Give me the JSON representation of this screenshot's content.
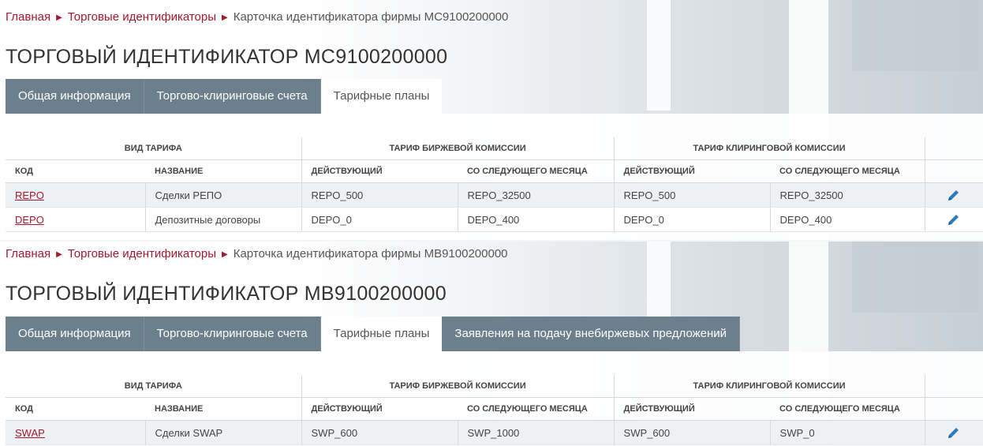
{
  "breadcrumb": {
    "home": "Главная",
    "trade_ids": "Торговые идентификаторы"
  },
  "colors": {
    "link_red": "#a3192e",
    "tab_inactive_bg": "#6b7f8c",
    "tab_active_bg": "#ffffff"
  },
  "panels": [
    {
      "breadcrumb_current": "Карточка идентификатора фирмы MC9100200000",
      "title": "ТОРГОВЫЙ ИДЕНТИФИКАТОР MC9100200000",
      "tabs": [
        "Общая информация",
        "Торгово-клиринговые счета",
        "Тарифные планы"
      ],
      "active_tab": "Тарифные планы",
      "table": {
        "groups": {
          "tariff_type": "ВИД ТАРИФА",
          "exchange_fee": "ТАРИФ БИРЖЕВОЙ КОМИССИИ",
          "clearing_fee": "ТАРИФ КЛИРИНГОВОЙ КОМИССИИ"
        },
        "columns": {
          "code": "КОД",
          "name": "НАЗВАНИЕ",
          "ex_current": "ДЕЙСТВУЮЩИЙ",
          "ex_next": "СО СЛЕДУЮЩЕГО МЕСЯЦА",
          "cl_current": "ДЕЙСТВУЮЩИЙ",
          "cl_next": "СО СЛЕДУЮЩЕГО МЕСЯЦА"
        },
        "rows": [
          {
            "code": "REPO",
            "name": "Сделки РЕПО",
            "ex_current": "REPO_500",
            "ex_next": "REPO_32500",
            "cl_current": "REPO_500",
            "cl_next": "REPO_32500"
          },
          {
            "code": "DEPO",
            "name": "Депозитные договоры",
            "ex_current": "DEPO_0",
            "ex_next": "DEPO_400",
            "cl_current": "DEPO_0",
            "cl_next": "DEPO_400"
          }
        ]
      }
    },
    {
      "breadcrumb_current": "Карточка идентификатора фирмы MB9100200000",
      "title": "ТОРГОВЫЙ ИДЕНТИФИКАТОР MB9100200000",
      "tabs": [
        "Общая информация",
        "Торгово-клиринговые счета",
        "Тарифные планы",
        "Заявления на подачу внебиржевых предложений"
      ],
      "active_tab": "Тарифные планы",
      "table": {
        "groups": {
          "tariff_type": "ВИД ТАРИФА",
          "exchange_fee": "ТАРИФ БИРЖЕВОЙ КОМИССИИ",
          "clearing_fee": "ТАРИФ КЛИРИНГОВОЙ КОМИССИИ"
        },
        "columns": {
          "code": "КОД",
          "name": "НАЗВАНИЕ",
          "ex_current": "ДЕЙСТВУЮЩИЙ",
          "ex_next": "СО СЛЕДУЮЩЕГО МЕСЯЦА",
          "cl_current": "ДЕЙСТВУЮЩИЙ",
          "cl_next": "СО СЛЕДУЮЩЕГО МЕСЯЦА"
        },
        "rows": [
          {
            "code": "SWAP",
            "name": "Сделки SWAP",
            "ex_current": "SWP_600",
            "ex_next": "SWP_1000",
            "cl_current": "SWP_600",
            "cl_next": "SWP_0"
          }
        ]
      }
    }
  ]
}
